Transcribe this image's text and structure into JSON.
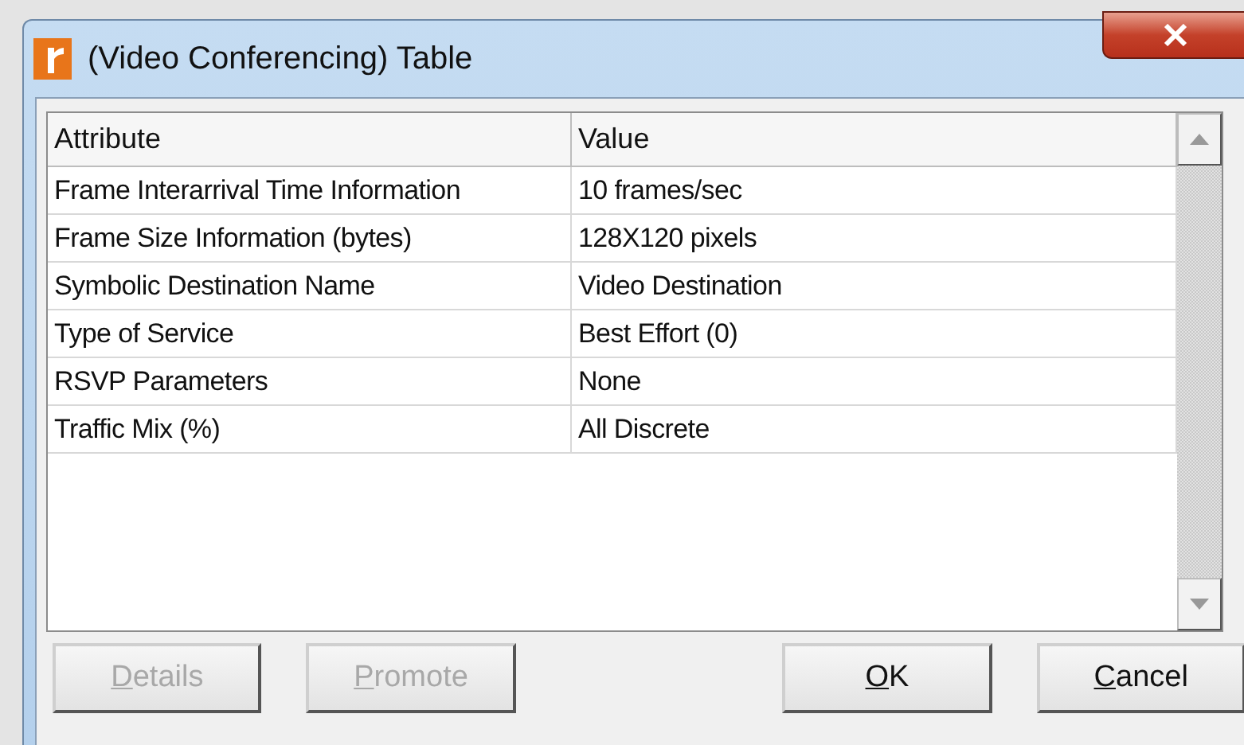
{
  "window": {
    "title": "(Video Conferencing) Table"
  },
  "table": {
    "columns": [
      "Attribute",
      "Value"
    ],
    "rows": [
      {
        "attribute": "Frame Interarrival Time Information",
        "value": "10 frames/sec"
      },
      {
        "attribute": "Frame Size Information (bytes)",
        "value": "128X120 pixels"
      },
      {
        "attribute": "Symbolic Destination Name",
        "value": "Video Destination"
      },
      {
        "attribute": "Type of Service",
        "value": "Best Effort (0)"
      },
      {
        "attribute": "RSVP Parameters",
        "value": "None"
      },
      {
        "attribute": "Traffic Mix (%)",
        "value": "All Discrete"
      }
    ]
  },
  "buttons": [
    {
      "label": "Details",
      "disabled": true,
      "mnemonic": true
    },
    {
      "label": "Promote",
      "disabled": true,
      "mnemonic": true
    },
    {
      "label": "OK",
      "disabled": false,
      "mnemonic": true
    },
    {
      "label": "Cancel",
      "disabled": false,
      "mnemonic": true
    }
  ]
}
